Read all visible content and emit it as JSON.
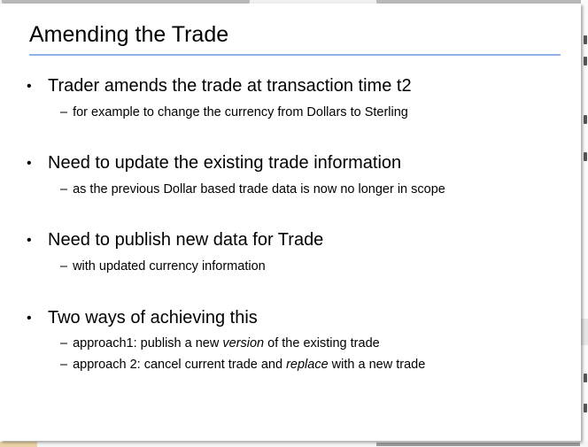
{
  "slide": {
    "title": "Amending the Trade",
    "bullets": [
      {
        "text": "Trader amends the trade at transaction time t2",
        "subs": [
          {
            "dash": "–",
            "parts": [
              "for example to change the currency from Dollars to Sterling"
            ]
          }
        ]
      },
      {
        "text": "Need to update the existing trade information",
        "subs": [
          {
            "dash": "–",
            "parts": [
              "as the previous Dollar based trade data is now no longer in scope"
            ]
          }
        ]
      },
      {
        "text": "Need to publish new data for Trade",
        "subs": [
          {
            "dash": "–",
            "parts": [
              "with updated currency information"
            ]
          }
        ]
      },
      {
        "text": "Two ways of achieving this",
        "subs": [
          {
            "dash": "–",
            "parts": [
              "approach1: publish a new ",
              "version",
              " of the existing trade"
            ]
          },
          {
            "dash": "–",
            "parts": [
              "approach 2: cancel current trade and ",
              "replace",
              " with a new trade"
            ]
          }
        ]
      }
    ],
    "bullet_symbol": "•",
    "accent_color": "#8fb3e6"
  }
}
